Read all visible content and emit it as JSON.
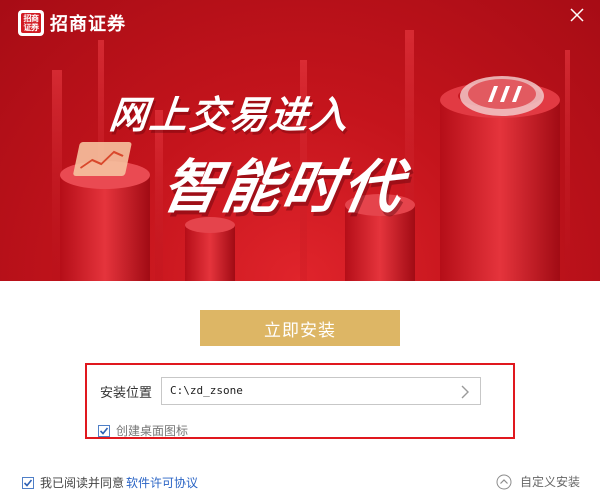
{
  "brand": {
    "logo_mark_text": "招商证券",
    "name": "招商证券"
  },
  "banner": {
    "headline_line1": "网上交易进入",
    "headline_line2": "智能时代"
  },
  "install": {
    "button_label": "立即安装",
    "path_label": "安装位置",
    "path_value": "C:\\zd_zsone",
    "shortcut_label": "创建桌面图标",
    "shortcut_checked": true
  },
  "footer": {
    "agree_checked": true,
    "agree_text": "我已阅读并同意",
    "license_link": "软件许可协议",
    "custom_install_label": "自定义安装"
  },
  "icons": {
    "close": "close-icon",
    "path_browse": "chevron-right-icon",
    "custom_install": "chevron-up-circle-icon"
  },
  "colors": {
    "banner_red": "#c4141c",
    "install_gold": "#ddb665",
    "highlight_red": "#e0181e",
    "link_blue": "#2a64c5"
  }
}
